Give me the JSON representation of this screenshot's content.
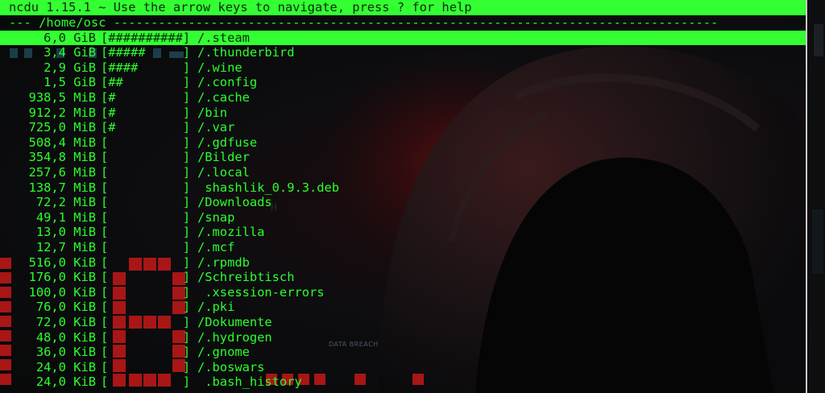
{
  "header": {
    "title": "ncdu 1.15.1 ~ Use the arrow keys to navigate, press ? for help"
  },
  "path_line": "--- /home/osc ---------------------------------------------------------------------------------",
  "entries": [
    {
      "size": "6,0 GiB",
      "bar": "[##########]",
      "name": "/.steam"
    },
    {
      "size": "3,4 GiB",
      "bar": "[#####     ]",
      "name": "/.thunderbird"
    },
    {
      "size": "2,9 GiB",
      "bar": "[####      ]",
      "name": "/.wine"
    },
    {
      "size": "1,5 GiB",
      "bar": "[##        ]",
      "name": "/.config"
    },
    {
      "size": "938,5 MiB",
      "bar": "[#         ]",
      "name": "/.cache"
    },
    {
      "size": "912,2 MiB",
      "bar": "[#         ]",
      "name": "/bin"
    },
    {
      "size": "725,0 MiB",
      "bar": "[#         ]",
      "name": "/.var"
    },
    {
      "size": "508,4 MiB",
      "bar": "[          ]",
      "name": "/.gdfuse"
    },
    {
      "size": "354,8 MiB",
      "bar": "[          ]",
      "name": "/Bilder"
    },
    {
      "size": "257,6 MiB",
      "bar": "[          ]",
      "name": "/.local"
    },
    {
      "size": "138,7 MiB",
      "bar": "[          ]",
      "name": " shashlik_0.9.3.deb"
    },
    {
      "size": "72,2 MiB",
      "bar": "[          ]",
      "name": "/Downloads"
    },
    {
      "size": "49,1 MiB",
      "bar": "[          ]",
      "name": "/snap"
    },
    {
      "size": "13,0 MiB",
      "bar": "[          ]",
      "name": "/.mozilla"
    },
    {
      "size": "12,7 MiB",
      "bar": "[          ]",
      "name": "/.mcf"
    },
    {
      "size": "516,0 KiB",
      "bar": "[          ]",
      "name": "/.rpmdb"
    },
    {
      "size": "176,0 KiB",
      "bar": "[          ]",
      "name": "/Schreibtisch"
    },
    {
      "size": "100,0 KiB",
      "bar": "[          ]",
      "name": " .xsession-errors"
    },
    {
      "size": "76,0 KiB",
      "bar": "[          ]",
      "name": "/.pki"
    },
    {
      "size": "72,0 KiB",
      "bar": "[          ]",
      "name": "/Dokumente"
    },
    {
      "size": "48,0 KiB",
      "bar": "[          ]",
      "name": "/.hydrogen"
    },
    {
      "size": "36,0 KiB",
      "bar": "[          ]",
      "name": "/.gnome"
    },
    {
      "size": "24,0 KiB",
      "bar": "[          ]",
      "name": "/.boswars"
    },
    {
      "size": "24,0 KiB",
      "bar": "[          ]",
      "name": " .bash_history"
    }
  ],
  "selected_index": 0,
  "background_text": "DATA BREACH",
  "colors": {
    "terminal_green": "#2bff2b",
    "highlight_bg": "#33ff33",
    "highlight_text": "#0b2b0b",
    "art_red": "#b01818"
  },
  "icons": {
    "background": "hooded-hacker-wallpaper"
  }
}
